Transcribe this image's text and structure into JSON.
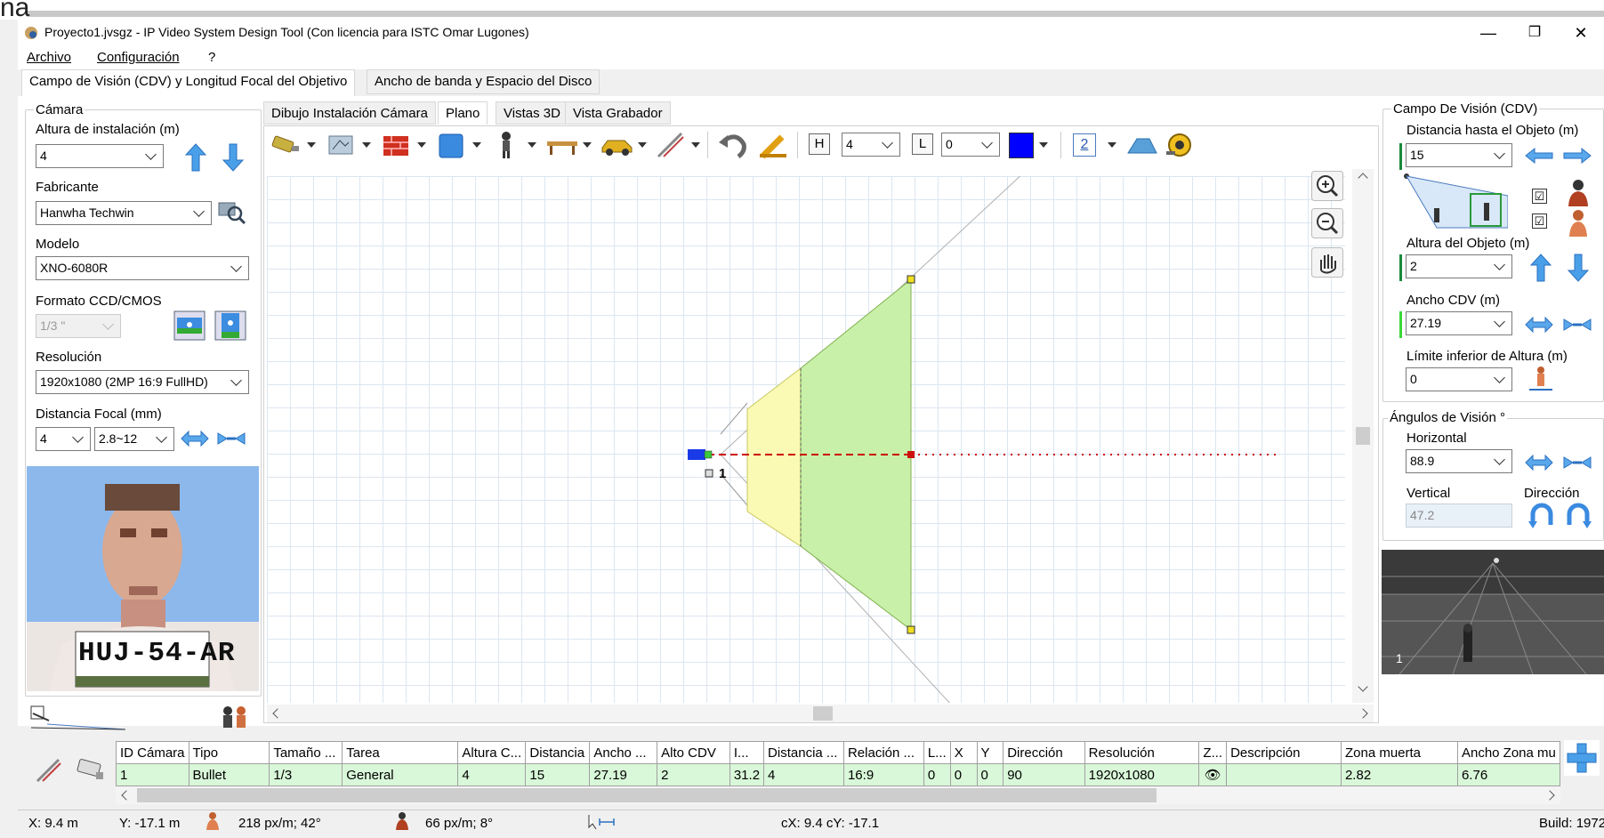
{
  "window": {
    "corner_text": "na",
    "title": "Proyecto1.jvsgz - IP Video System Design Tool (Con licencia para ISTC Omar Lugones)",
    "minimize": "—",
    "restore": "❐",
    "close": "✕"
  },
  "menu": [
    "Archivo",
    "Configuración",
    "?"
  ],
  "main_tabs": [
    "Campo de Visión (CDV) y Longitud Focal del Objetivo",
    "Ancho de banda y Espacio del Disco"
  ],
  "left": {
    "camera_group": "Cámara",
    "height_label": "Altura de instalación (m)",
    "height_value": "4",
    "maker_label": "Fabricante",
    "maker_value": "Hanwha Techwin",
    "model_label": "Modelo",
    "model_value": "XNO-6080R",
    "sensor_label": "Formato CCD/CMOS",
    "sensor_value": "1/3 \"",
    "resolution_label": "Resolución",
    "resolution_value": "1920x1080 (2MP 16:9 FullHD)",
    "focal_label": "Distancia Focal (mm)",
    "focal_value": "4",
    "focal_range": "2.8~12",
    "plate_text": "HUJ-54-AR"
  },
  "sub_tabs": [
    "Dibujo Instalación Cámara",
    "Plano",
    "Vistas 3D",
    "Vista Grabador"
  ],
  "toolbar": {
    "h_label": "H",
    "h_value": "4",
    "l_label": "L",
    "l_value": "0",
    "layer": "2",
    "color": "#0000ff"
  },
  "plan": {
    "camera_label": "1",
    "fov_far_color": "#c8f0a8",
    "fov_near_color": "#fafab4"
  },
  "right": {
    "fov_group": "Campo De Visión (CDV)",
    "distance_label": "Distancia hasta el Objeto (m)",
    "distance_value": "15",
    "obj_height_label": "Altura del Objeto (m)",
    "obj_height_value": "2",
    "width_label": "Ancho CDV (m)",
    "width_value": "27.19",
    "lower_limit_label": "Límite inferior de Altura (m)",
    "lower_limit_value": "0",
    "angles_group": "Ángulos de Visión °",
    "horizontal_label": "Horizontal",
    "horizontal_value": "88.9",
    "vertical_label": "Vertical",
    "vertical_value": "47.2",
    "direction_label": "Dirección",
    "preview_label": "1",
    "check_mark": "☑"
  },
  "table": {
    "headers": [
      "ID Cámara",
      "Tipo",
      "Tamaño ...",
      "Tarea",
      "Altura C...",
      "Distancia",
      "Ancho ...",
      "Alto CDV",
      "I...",
      "Distancia ...",
      "Relación ...",
      "L...",
      "X",
      "Y",
      "Dirección",
      "Resolución",
      "Z...",
      "Descripción",
      "Zona muerta",
      "Ancho Zona mu"
    ],
    "row": [
      "1",
      "Bullet",
      "1/3",
      "General",
      "4",
      "15",
      "27.19",
      "2",
      "31.2",
      "4",
      "16:9",
      "0",
      "0",
      "0",
      "90",
      "1920x1080",
      "👁",
      "",
      "2.82",
      "6.76"
    ]
  },
  "status": {
    "x": "X: 9.4 m",
    "y": "Y: -17.1 m",
    "ppm1": "218 px/m; 42°",
    "ppm2": "66 px/m; 8°",
    "cxy": "cX: 9.4 cY: -17.1",
    "build": "Build: 1972"
  }
}
